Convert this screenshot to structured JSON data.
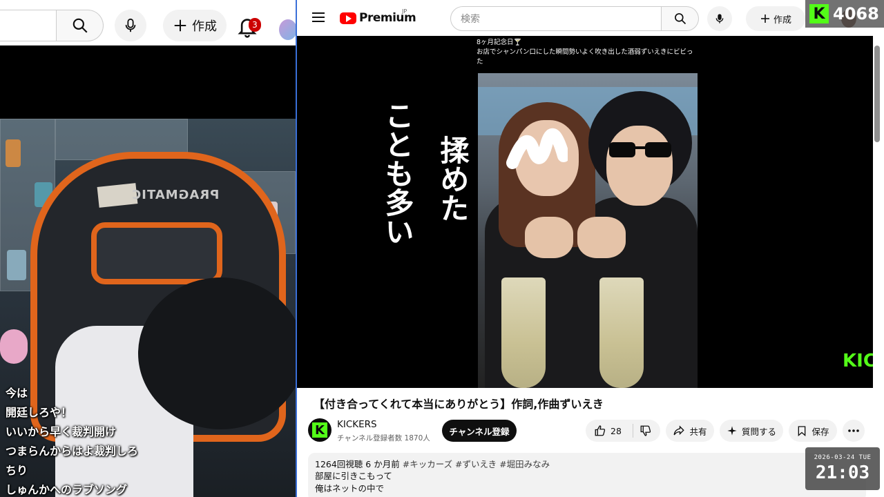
{
  "left_header": {
    "create_label": "作成",
    "notification_count": "3"
  },
  "chat": [
    "今は",
    "開廷しろや！",
    "いいから早く裁判開け",
    "つまらんからはよ裁判しろ",
    "ちり",
    "しゅんかへのラブソング"
  ],
  "chair_logo": "PRAGMATIC",
  "youtube": {
    "brand": "Premium",
    "region": "JP",
    "search_placeholder": "検索",
    "create_label": "作成",
    "video": {
      "caption_line1": "8ヶ月記念日🍸",
      "caption_line2": "お店でシャンパン口にした瞬間勢いよく吹き出した酒弱ずいえきにビビっ",
      "caption_line3": "た",
      "vertical_left": "ことも多い",
      "vertical_right": "揉めた",
      "watermark": "KICK"
    },
    "title": "【付き合ってくれて本当にありがとう】作詞,作曲ずいえき",
    "channel": {
      "name": "KICKERS",
      "subscribers": "チャンネル登録者数 1870人",
      "subscribe_label": "チャンネル登録"
    },
    "actions": {
      "likes": "28",
      "share_label": "共有",
      "ask_label": "質問する",
      "save_label": "保存"
    },
    "description": {
      "views": "1264回視聴",
      "age": "6 か月前",
      "tags": "#キッカーズ #ずいえき #堀田みなみ",
      "line1": "部屋に引きこもって",
      "line2": "俺はネットの中で"
    }
  },
  "kick_viewers": {
    "logo": "K",
    "count": "4068"
  },
  "clock": {
    "date": "2026-03-24 TUE",
    "time": "21:03"
  },
  "colors": {
    "youtube_red": "#ff0000",
    "kick_green": "#53fc18",
    "chair_orange": "#e0651c"
  }
}
